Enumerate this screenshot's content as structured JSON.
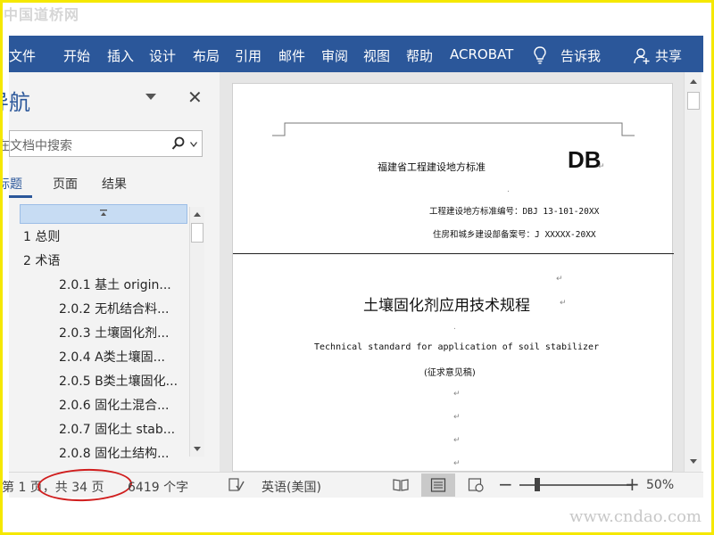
{
  "watermark": {
    "top": "中国道桥网",
    "bottom": "www.cndao.com"
  },
  "ribbon": {
    "tabs": [
      {
        "label": "文件"
      },
      {
        "label": "开始"
      },
      {
        "label": "插入"
      },
      {
        "label": "设计"
      },
      {
        "label": "布局"
      },
      {
        "label": "引用"
      },
      {
        "label": "邮件"
      },
      {
        "label": "审阅"
      },
      {
        "label": "视图"
      },
      {
        "label": "帮助"
      },
      {
        "label": "ACROBAT"
      }
    ],
    "tell_me": "告诉我",
    "share": "共享",
    "color": "#2b579a"
  },
  "nav": {
    "title": "导航",
    "search_placeholder": "在文档中搜索",
    "subtabs": [
      "标题",
      "页面",
      "结果"
    ],
    "active_subtab": "标题",
    "items": [
      {
        "label": "1  总则"
      },
      {
        "label": "2  术语"
      },
      {
        "label": "2.0.1  基土  origin..."
      },
      {
        "label": "2.0.2  无机结合料..."
      },
      {
        "label": "2.0.3  土壤固化剂..."
      },
      {
        "label": "2.0.4  A类土壤固..."
      },
      {
        "label": "2.0.5  B类土壤固化..."
      },
      {
        "label": "2.0.6  固化土混合..."
      },
      {
        "label": "2.0.7  固化土  stab..."
      },
      {
        "label": "2.0.8  固化土结构..."
      }
    ]
  },
  "document": {
    "header_org": "福建省工程建设地方标准",
    "header_code": "DB",
    "std_number": "工程建设地方标准编号：DBJ 13-101-20XX",
    "record_number": "住房和城乡建设部备案号：J XXXXX-20XX",
    "title_cn": "土壤固化剂应用技术规程",
    "title_en": "Technical standard for application of soil stabilizer",
    "draft_note": "(征求意见稿)"
  },
  "status": {
    "page_of": "第 1 页，共 34 页",
    "word_count": "6419 个字",
    "language": "英语(美国)",
    "zoom": "50%",
    "zoom_level": 0.5
  }
}
